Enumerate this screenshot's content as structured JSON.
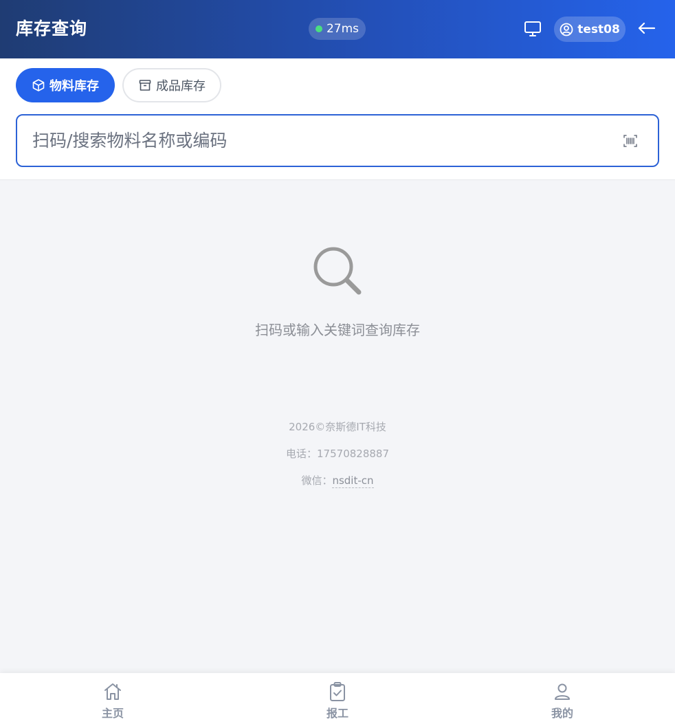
{
  "header": {
    "title": "库存查询",
    "latency": "27ms",
    "username": "test08",
    "accent_color": "#2563eb",
    "status_color": "#4ade80"
  },
  "tabs": [
    {
      "label": "物料库存",
      "icon": "cube-icon",
      "active": true
    },
    {
      "label": "成品库存",
      "icon": "archive-box-icon",
      "active": false
    }
  ],
  "search": {
    "placeholder": "扫码/搜索物料名称或编码",
    "value": "",
    "scan_icon": "barcode-scan-icon"
  },
  "empty_state": {
    "icon": "magnifier-icon",
    "text": "扫码或输入关键词查询库存"
  },
  "footer": {
    "copyright": "2026©奈斯德IT科技",
    "phone_label": "电话：",
    "phone": "17570828887",
    "wechat_label": "微信：",
    "wechat": "nsdit-cn"
  },
  "bottom_nav": [
    {
      "label": "主页",
      "icon": "home-icon"
    },
    {
      "label": "报工",
      "icon": "clipboard-check-icon"
    },
    {
      "label": "我的",
      "icon": "user-icon"
    }
  ]
}
